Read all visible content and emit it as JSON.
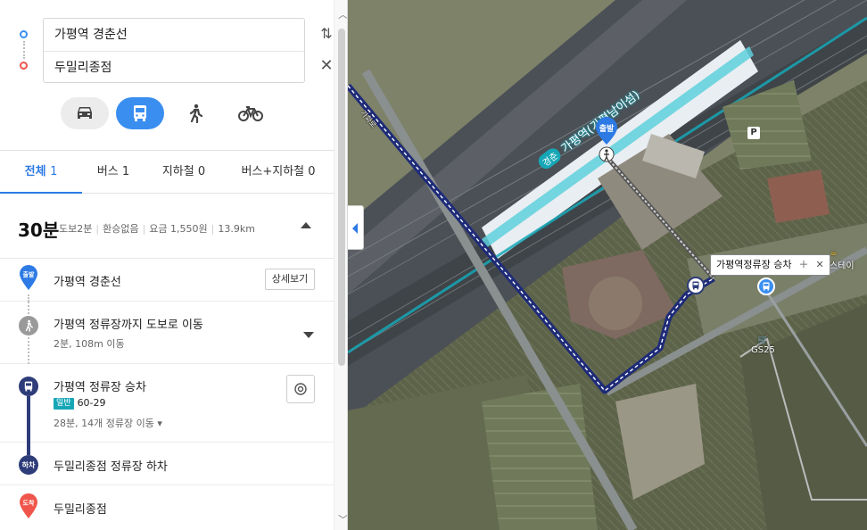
{
  "search": {
    "origin": "가평역 경춘선",
    "destination": "두밀리종점"
  },
  "modes": [
    {
      "name": "car",
      "icon": "car-icon"
    },
    {
      "name": "transit",
      "icon": "bus-icon",
      "active": true
    },
    {
      "name": "walk",
      "icon": "walk-icon"
    },
    {
      "name": "bike",
      "icon": "bike-icon"
    }
  ],
  "tabs": [
    {
      "label": "전체",
      "count": "1"
    },
    {
      "label": "버스",
      "count": "1"
    },
    {
      "label": "지하철",
      "count": "0"
    },
    {
      "label": "버스+지하철",
      "count": "0"
    }
  ],
  "summary": {
    "time": "30분",
    "walk": "도보2분",
    "transfer": "환승없음",
    "fare": "요금 1,550원",
    "distance": "13.9km"
  },
  "steps": {
    "start": {
      "badge": "출발",
      "title": "가평역 경춘선",
      "button": "상세보기"
    },
    "walk": {
      "title": "가평역 정류장까지 도보로 이동",
      "sub": "2분, 108m 이동"
    },
    "board": {
      "title": "가평역 정류장 승차",
      "bus_type": "일반",
      "bus_no": "60-29",
      "sub": "28분, 14개 정류장 이동 ▾"
    },
    "alight": {
      "badge": "하차",
      "title": "두밀리종점 정류장 하차"
    },
    "end": {
      "badge": "도착",
      "title": "두밀리종점"
    }
  },
  "map": {
    "start_marker": "출발",
    "popup": "가평역정류장 승차",
    "station_line": "경춘",
    "station_name": "가평역(가평남이섬)",
    "gs_label": "GS25",
    "cafe_label": "스테이",
    "parking": "P"
  },
  "colors": {
    "accent": "#2d7ae5",
    "transit_active": "#3a8ef0",
    "bus_route": "#2e3c7a",
    "end_marker": "#f0554b",
    "rail_line": "#16a7b7"
  }
}
